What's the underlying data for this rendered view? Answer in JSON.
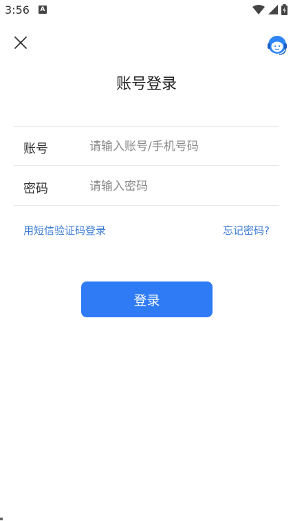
{
  "status_bar": {
    "time": "3:56",
    "notification_letter": "A"
  },
  "page": {
    "title": "账号登录"
  },
  "form": {
    "account_label": "账号",
    "account_placeholder": "请输入账号/手机号码",
    "password_label": "密码",
    "password_placeholder": "请输入密码"
  },
  "links": {
    "sms_login": "用短信验证码登录",
    "forgot_password": "忘记密码?"
  },
  "actions": {
    "login_label": "登录"
  },
  "colors": {
    "accent": "#2f7bf5",
    "link": "#3a7bd5"
  }
}
